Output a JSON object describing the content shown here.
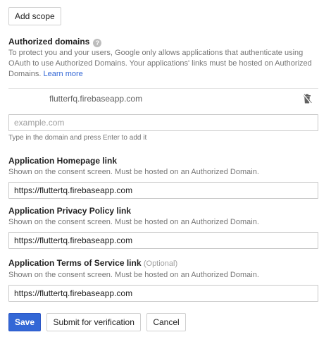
{
  "buttons": {
    "add_scope": "Add scope",
    "save": "Save",
    "submit_verification": "Submit for verification",
    "cancel": "Cancel"
  },
  "authorized_domains": {
    "title": "Authorized domains",
    "description": "To protect you and your users, Google only allows applications that authenticate using OAuth to use Authorized Domains. Your applications' links must be hosted on Authorized Domains.",
    "learn_more": "Learn more",
    "domains": [
      "flutterfq.firebaseapp.com"
    ],
    "input_placeholder": "example.com",
    "input_value": "",
    "input_hint": "Type in the domain and press Enter to add it"
  },
  "homepage": {
    "title": "Application Homepage link",
    "description": "Shown on the consent screen. Must be hosted on an Authorized Domain.",
    "value": "https://fluttertq.firebaseapp.com"
  },
  "privacy": {
    "title": "Application Privacy Policy link",
    "description": "Shown on the consent screen. Must be hosted on an Authorized Domain.",
    "value": "https://fluttertq.firebaseapp.com"
  },
  "terms": {
    "title": "Application Terms of Service link",
    "optional": "(Optional)",
    "description": "Shown on the consent screen. Must be hosted on an Authorized Domain.",
    "value": "https://fluttertq.firebaseapp.com"
  },
  "colors": {
    "primary": "#3367d6",
    "link": "#3367d6",
    "muted_text": "#757575"
  },
  "icons": {
    "help": "help-icon",
    "delete": "trash-icon"
  }
}
